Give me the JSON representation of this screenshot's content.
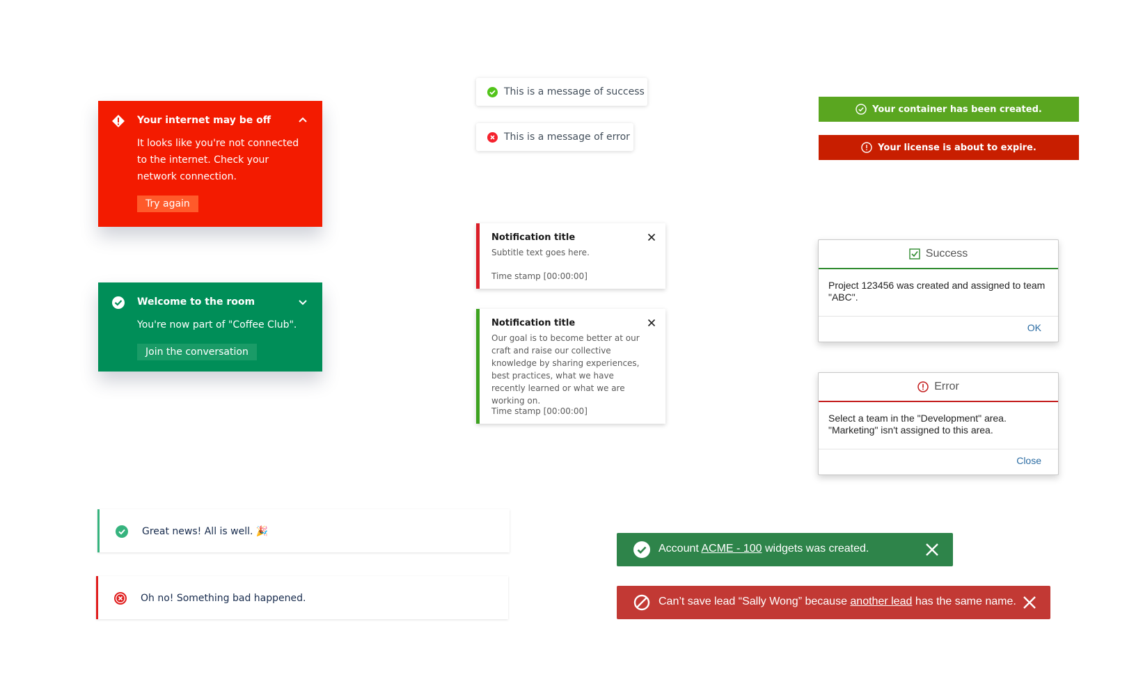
{
  "connection_card": {
    "title": "Your internet may be off",
    "body": "It looks like you're not connected to the internet. Check your network connection.",
    "button": "Try again",
    "color": "#f31b00"
  },
  "welcome_card": {
    "title": "Welcome to the room",
    "body": "You're now part of \"Coffee Club\".",
    "button": "Join the conversation",
    "color": "#008e58"
  },
  "toasts": {
    "success": "This is a message of success",
    "error": "This is a message of error"
  },
  "notifications": [
    {
      "title": "Notification title",
      "subtitle": "Subtitle text goes here.",
      "timestamp": "Time stamp [00:00:00]",
      "accent": "#da1e28"
    },
    {
      "title": "Notification title",
      "subtitle": "Our goal is to become better at our craft and raise our collective knowledge by sharing experiences, best practices, what we have recently learned or what we are working on.",
      "timestamp": "Time stamp [00:00:00]",
      "accent": "#3da220"
    }
  ],
  "banners": {
    "success": "Your container has been created.",
    "error": "Your license is about to expire."
  },
  "dialogs": {
    "success": {
      "title": "Success",
      "body": "Project 123456 was created and assigned to team \"ABC\".",
      "button": "OK"
    },
    "error": {
      "title": "Error",
      "body": "Select a team in the \"Development\" area. \"Marketing\" isn't assigned to this area.",
      "button": "Close"
    }
  },
  "inline_alerts": {
    "success": "Great news! All is well. 🎉",
    "error": "Oh no! Something bad happened."
  },
  "record_toasts": {
    "success": {
      "prefix": "Account ",
      "link": "ACME - 100",
      "suffix": " widgets was created."
    },
    "error": {
      "prefix": "Can’t save lead “Sally Wong” because ",
      "link": "another lead",
      "suffix": " has the same name."
    }
  }
}
